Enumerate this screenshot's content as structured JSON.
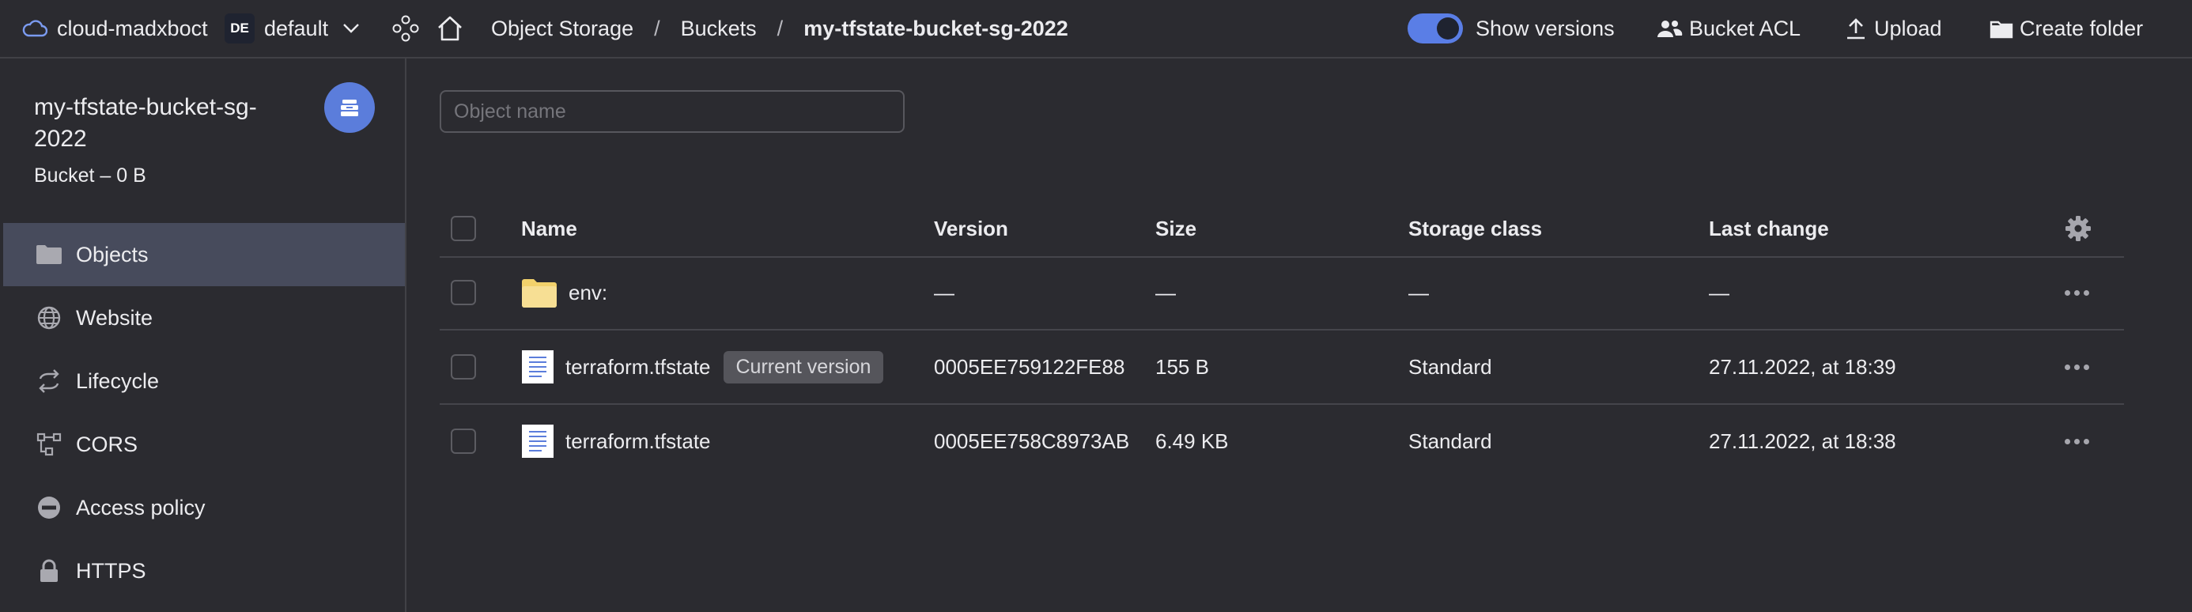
{
  "topbar": {
    "cloud_name": "cloud-madxboct",
    "workspace_badge": "DE",
    "folder_name": "default",
    "breadcrumb": {
      "service": "Object Storage",
      "sep1": "/",
      "buckets": "Buckets",
      "sep2": "/",
      "current": "my-tfstate-bucket-sg-2022"
    },
    "show_versions_label": "Show versions",
    "show_versions_enabled": true,
    "bucket_acl_label": "Bucket ACL",
    "upload_label": "Upload",
    "create_folder_label": "Create folder"
  },
  "sidebar": {
    "bucket_name": "my-tfstate-bucket-sg-2022",
    "bucket_info": "Bucket – 0 B",
    "items": [
      {
        "label": "Objects",
        "icon": "folder-icon",
        "active": true
      },
      {
        "label": "Website",
        "icon": "globe-icon",
        "active": false
      },
      {
        "label": "Lifecycle",
        "icon": "cycle-arrows-icon",
        "active": false
      },
      {
        "label": "CORS",
        "icon": "cors-network-icon",
        "active": false
      },
      {
        "label": "Access policy",
        "icon": "no-entry-icon",
        "active": false
      },
      {
        "label": "HTTPS",
        "icon": "lock-icon",
        "active": false
      }
    ]
  },
  "main": {
    "search_placeholder": "Object name",
    "columns": {
      "name": "Name",
      "version": "Version",
      "size": "Size",
      "storage_class": "Storage class",
      "last_change": "Last change"
    },
    "rows": [
      {
        "type": "folder",
        "name": "env:",
        "badge": "",
        "version": "—",
        "size": "—",
        "storage_class": "—",
        "last_change": "—"
      },
      {
        "type": "file",
        "name": "terraform.tfstate",
        "badge": "Current version",
        "version": "0005EE759122FE88",
        "size": "155 B",
        "storage_class": "Standard",
        "last_change": "27.11.2022, at 18:39"
      },
      {
        "type": "file",
        "name": "terraform.tfstate",
        "badge": "",
        "version": "0005EE758C8973AB",
        "size": "6.49 KB",
        "storage_class": "Standard",
        "last_change": "27.11.2022, at 18:38"
      }
    ]
  },
  "colors": {
    "background": "#2b2b30",
    "accent": "#5a7ee6",
    "active_nav": "#474b5c",
    "folder": "#f5d77a"
  }
}
